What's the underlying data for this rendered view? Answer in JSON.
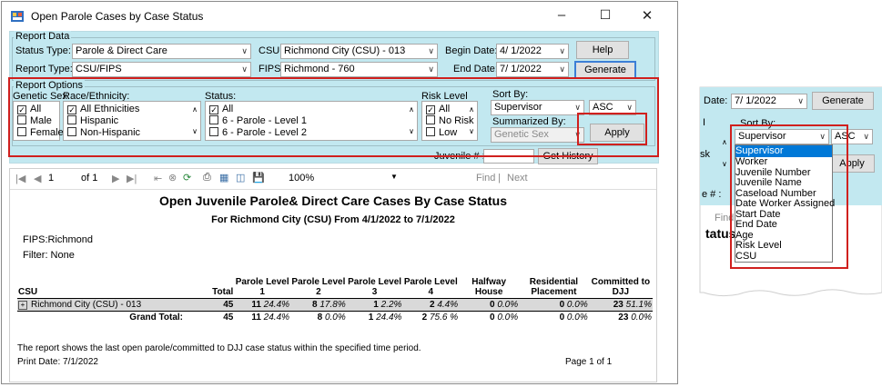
{
  "window": {
    "title": "Open Parole Cases by Case Status"
  },
  "report_data": {
    "group_title": "Report Data",
    "status_type_label": "Status Type:",
    "status_type_value": "Parole & Direct Care",
    "report_type_label": "Report Type:",
    "report_type_value": "CSU/FIPS",
    "csu_label": "CSU:",
    "csu_value": "Richmond City (CSU) - 013",
    "fips_label": "FIPS:",
    "fips_value": "Richmond - 760",
    "begin_date_label": "Begin Date:",
    "begin_date_value": "4/  1/2022",
    "end_date_label": "End Date:",
    "end_date_value": "7/  1/2022",
    "help_button": "Help",
    "generate_button": "Generate"
  },
  "report_options": {
    "group_title": "Report Options",
    "genetic_sex_label": "Genetic Sex:",
    "genetic_sex_items": [
      "All",
      "Male",
      "Female"
    ],
    "race_label": "Race/Ethnicity:",
    "race_items": [
      "All Ethnicities",
      "Hispanic",
      "Non-Hispanic"
    ],
    "status_label": "Status:",
    "status_items": [
      "All",
      "6 - Parole - Level 1",
      "6 - Parole - Level 2"
    ],
    "risk_label": "Risk Level",
    "risk_items": [
      "All",
      "No Risk",
      "Low"
    ],
    "sort_by_label": "Sort By:",
    "sort_by_value": "Supervisor",
    "sort_dir_value": "ASC",
    "summarized_by_label": "Summarized By:",
    "summarized_by_value": "Genetic Sex",
    "apply_button": "Apply"
  },
  "juvenile": {
    "label": "Juvenile # :",
    "value": "",
    "get_history_button": "Get History"
  },
  "toolbar": {
    "page_current": "1",
    "page_of": "of 1",
    "zoom": "100%",
    "find_label": "Find",
    "next_label": "Next"
  },
  "report": {
    "title": "Open Juvenile Parole& Direct Care Cases By Case Status",
    "subtitle": "For Richmond City (CSU) From 4/1/2022 to 7/1/2022",
    "fips_line": "FIPS:Richmond",
    "filter_line": "Filter: None",
    "columns": [
      "CSU",
      "Total",
      "Parole Level 1",
      "Parole Level 2",
      "Parole Level 3",
      "Parole Level 4",
      "Halfway House",
      "Residential Placement",
      "Committed to DJJ"
    ],
    "row": {
      "csu": "Richmond City (CSU) - 013",
      "cells": [
        "45",
        "11",
        "24.4%",
        "8",
        "17.8%",
        "1",
        "2.2%",
        "2",
        "4.4%",
        "0",
        "0.0%",
        "0",
        "0.0%",
        "23",
        "51.1%"
      ]
    },
    "grand_total": {
      "label": "Grand Total:",
      "cells": [
        "45",
        "11",
        "24.4%",
        "8",
        "0.0%",
        "1",
        "24.4%",
        "2",
        "75.6 %",
        "0",
        "0.0%",
        "0",
        "0.0%",
        "23",
        "0.0%"
      ]
    },
    "footnote": "The report shows the last open parole/committed to DJJ case status within the specified time period.",
    "print_date": "Print Date: 7/1/2022",
    "page": "Page 1 of 1"
  },
  "zoom_panel": {
    "date_label": "Date:",
    "date_value": "7/  1/2022",
    "generate_button": "Generate",
    "sort_by_label": "Sort By:",
    "sort_by_value": "Supervisor",
    "sort_dir_value": "ASC",
    "apply_button": "Apply",
    "left_fragment_1": "I",
    "left_fragment_2": "sk",
    "juv_fragment": "e # :",
    "find_fragment": "Find",
    "status_fragment": "tatus",
    "dropdown_options": [
      "Supervisor",
      "Worker",
      "Juvenile Number",
      "Juvenile Name",
      "Caseload Number",
      "Date Worker Assigned",
      "Start Date",
      "End Date",
      "Age",
      "Risk Level",
      "CSU"
    ],
    "selected_index": 0
  },
  "colors": {
    "panel": "#c2e8f0",
    "highlight": "#d0201e",
    "selection": "#0078d7"
  }
}
